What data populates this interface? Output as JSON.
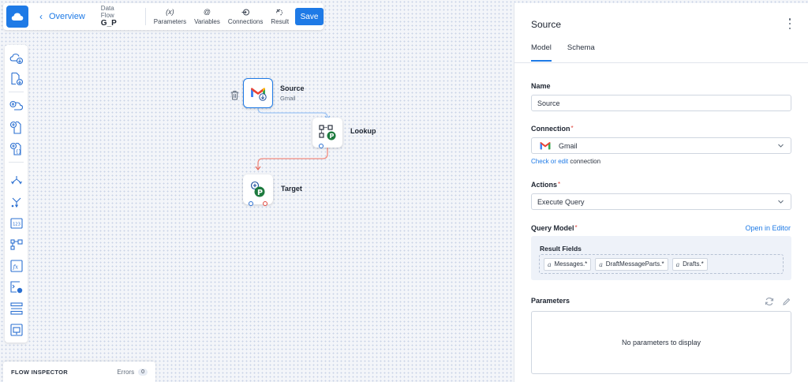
{
  "toolbar": {
    "back_label": "Overview",
    "flow_kind": "Data Flow",
    "flow_name": "G_P",
    "buttons": [
      {
        "icon": "(x)",
        "label": "Parameters"
      },
      {
        "icon": "@",
        "label": "Variables"
      },
      {
        "icon": "→",
        "label": "Connections"
      },
      {
        "icon": "✕",
        "label": "Result"
      }
    ],
    "save_label": "Save"
  },
  "palette": {
    "items": [
      "cloud-source",
      "file-source",
      "cloud-target",
      "file-target",
      "json-target",
      "split",
      "merge",
      "value",
      "lookup",
      "expression",
      "execute-command",
      "buffer",
      "extend"
    ]
  },
  "canvas": {
    "nodes": [
      {
        "id": "source",
        "label": "Source",
        "sublabel": "Gmail"
      },
      {
        "id": "lookup",
        "label": "Lookup"
      },
      {
        "id": "target",
        "label": "Target"
      }
    ]
  },
  "inspector": {
    "title": "FLOW INSPECTOR",
    "errors_label": "Errors",
    "errors_count": "0"
  },
  "panel": {
    "title": "Source",
    "tabs": [
      "Model",
      "Schema"
    ],
    "name_label": "Name",
    "name_value": "Source",
    "connection_label": "Connection",
    "connection_value": "Gmail",
    "connection_hint_link": "Check or edit",
    "connection_hint_text": " connection",
    "actions_label": "Actions",
    "actions_value": "Execute Query",
    "query_model_label": "Query Model",
    "open_in_editor": "Open in Editor",
    "result_fields_label": "Result Fields",
    "result_fields": [
      "Messages.*",
      "DraftMessageParts.*",
      "Drafts.*"
    ],
    "chip_icon": "a",
    "parameters_label": "Parameters",
    "parameters_empty": "No parameters to display",
    "required_mark": "*"
  },
  "colors": {
    "accent": "#1e7ae6",
    "lookup_link": "#9ec5f5",
    "target_link": "#f08a7e"
  }
}
